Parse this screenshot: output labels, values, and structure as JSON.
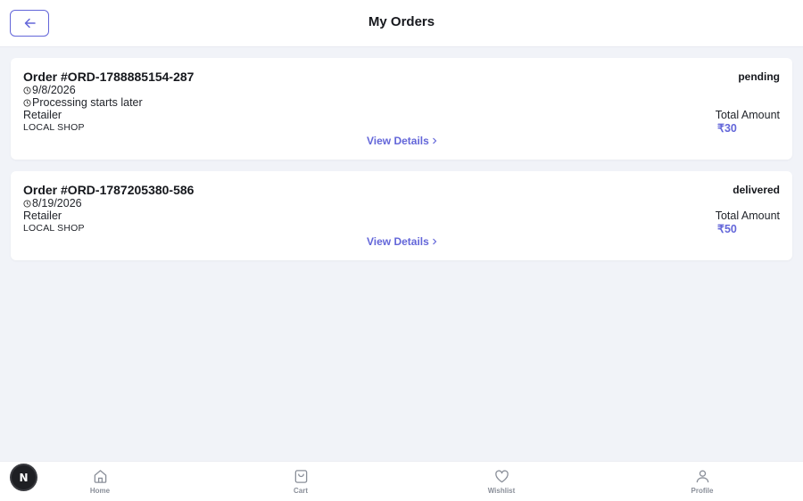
{
  "header": {
    "title": "My Orders",
    "back_icon": "arrow-left-icon"
  },
  "orders": [
    {
      "id": "Order #ORD-1788885154-287",
      "date": "9/8/2026",
      "note": "Processing starts later",
      "retailer_label": "Retailer",
      "shop": "LOCAL SHOP",
      "status": "pending",
      "total_label": "Total Amount",
      "total": "₹30",
      "view_details": "View Details"
    },
    {
      "id": "Order #ORD-1787205380-586",
      "date": "8/19/2026",
      "retailer_label": "Retailer",
      "shop": "LOCAL SHOP",
      "status": "delivered",
      "total_label": "Total Amount",
      "total": "₹50",
      "view_details": "View Details"
    }
  ],
  "nav": {
    "items": [
      {
        "label": "Home",
        "icon": "home-icon"
      },
      {
        "label": "Cart",
        "icon": "shopping-bag-icon"
      },
      {
        "label": "Wishlist",
        "icon": "heart-icon"
      },
      {
        "label": "Profile",
        "icon": "user-icon"
      }
    ]
  },
  "fab": {
    "letter": "N"
  },
  "colors": {
    "accent": "#6366d9",
    "background": "#f1f3f8",
    "card": "#ffffff",
    "nav_label": "#8a8f99"
  }
}
